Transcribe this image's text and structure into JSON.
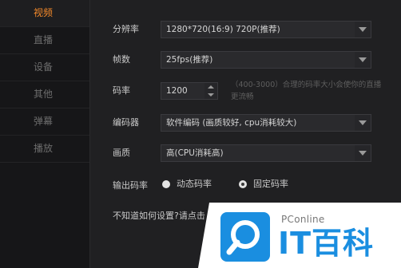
{
  "sidebar": {
    "items": [
      {
        "label": "视频",
        "active": true
      },
      {
        "label": "直播",
        "active": false
      },
      {
        "label": "设备",
        "active": false
      },
      {
        "label": "其他",
        "active": false
      },
      {
        "label": "弹幕",
        "active": false
      },
      {
        "label": "播放",
        "active": false
      }
    ]
  },
  "settings": {
    "resolution": {
      "label": "分辨率",
      "value": "1280*720(16:9) 720P(推荐)"
    },
    "framerate": {
      "label": "帧数",
      "value": "25fps(推荐)"
    },
    "bitrate": {
      "label": "码率",
      "value": "1200",
      "hint": "（400-3000）合理的码率大小会使你的直播更流畅"
    },
    "encoder": {
      "label": "编码器",
      "value": "软件编码 (画质较好, cpu消耗较大)"
    },
    "quality": {
      "label": "画质",
      "value": "高(CPU消耗高)"
    },
    "output_mode": {
      "label": "输出码率",
      "options": [
        {
          "label": "动态码率",
          "selected": false
        },
        {
          "label": "固定码率",
          "selected": true
        }
      ]
    },
    "help_text": "不知道如何设置?请点击"
  },
  "watermark": {
    "brand": "PConline",
    "title": "IT百科"
  },
  "colors": {
    "accent": "#f58a2a",
    "watermark_blue": "#1a8ee0"
  }
}
